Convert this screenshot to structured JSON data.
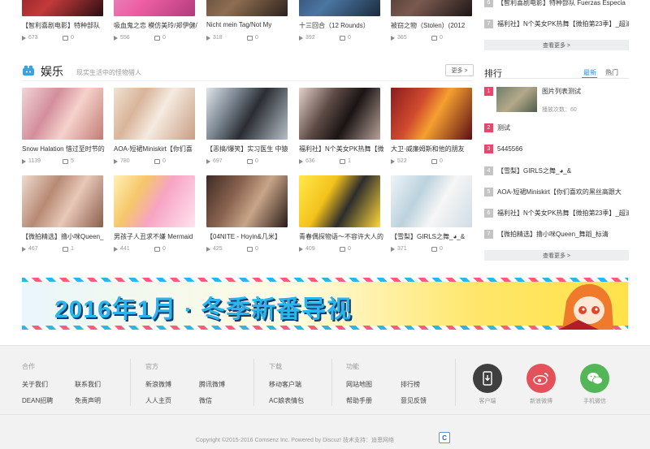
{
  "top_row": [
    {
      "caption": "【智利喜剧电影】特种部队",
      "plays": "673",
      "comments": "0"
    },
    {
      "caption": "吸血鬼之恋 模仿美玲/郑伊健/",
      "plays": "556",
      "comments": "0"
    },
    {
      "caption": "Nicht mein Tag/Not My",
      "plays": "318",
      "comments": "0"
    },
    {
      "caption": "十三回合（12 Rounds）",
      "plays": "392",
      "comments": "0"
    },
    {
      "caption": "被窃之物（Stolen）(2012",
      "plays": "365",
      "comments": "0"
    }
  ],
  "section": {
    "title": "娱乐",
    "subtitle": "现实生活中的怪物猎人",
    "more": "更多 >"
  },
  "row1": [
    {
      "caption": "Snow Halation 惜过至时节的",
      "plays": "1139",
      "comments": "5"
    },
    {
      "caption": "AOA-短裙Miniskirt【你们喜",
      "plays": "780",
      "comments": "0"
    },
    {
      "caption": "【恶搞/爆笑】实习医生 中猿",
      "plays": "697",
      "comments": "0"
    },
    {
      "caption": "福利社】N个美女PK热舞【微",
      "plays": "636",
      "comments": "1"
    },
    {
      "caption": "大卫·威廉姆斯和他的朋友",
      "plays": "522",
      "comments": "0"
    }
  ],
  "row2": [
    {
      "caption": "【微拍精选】撸小咪Queen_",
      "plays": "467",
      "comments": "1"
    },
    {
      "caption": "男孩子人丑求不嫌 Mermaid",
      "plays": "441",
      "comments": "0"
    },
    {
      "caption": "【04NITE - Hoyin&几米】",
      "plays": "425",
      "comments": "0"
    },
    {
      "caption": "青春偶探物语～不容许大人的",
      "plays": "409",
      "comments": "0"
    },
    {
      "caption": "【雪梨】GIRLS之舞_◕_&",
      "plays": "371",
      "comments": "0"
    }
  ],
  "sidebar_top": {
    "items": [
      {
        "num": "6",
        "text": "【智利喜剧电影】特种部队 Fuerzas Especia"
      },
      {
        "num": "7",
        "text": "福利社】N个美女PK热舞【微拍第23季】_超清"
      }
    ],
    "more": "查看更多 >"
  },
  "ranking": {
    "title": "排行",
    "tabs": [
      "最新",
      "热门"
    ],
    "featured": {
      "num": "1",
      "title": "图片列表测试",
      "meta": "播放次数：60"
    },
    "items": [
      {
        "num": "2",
        "text": "测试"
      },
      {
        "num": "3",
        "text": "5445566"
      },
      {
        "num": "4",
        "text": "【雪梨】GIRLS之舞_◕_&"
      },
      {
        "num": "5",
        "text": "AOA-短裙Miniskirt【你们喜欢的黑丝高跟大"
      },
      {
        "num": "6",
        "text": "福利社】N个美女PK热舞【微拍第23季】_超清"
      },
      {
        "num": "7",
        "text": "【微拍精选】撸小咪Queen_舞蹈_标清"
      }
    ],
    "more": "查看更多 >"
  },
  "banner": {
    "text": "2016年1月 · 冬季新番导视"
  },
  "footer": {
    "cols": [
      {
        "heading": "合作",
        "links": [
          "关于我们",
          "联系我们",
          "DEAN招聘",
          "免责声明"
        ]
      },
      {
        "heading": "官方",
        "links": [
          "新浪微博",
          "腾讯微博",
          "人人主页",
          "微信"
        ]
      },
      {
        "heading": "下载",
        "links": [
          "移动客户端",
          "AC娘表情包"
        ]
      },
      {
        "heading": "功能",
        "links": [
          "网站地图",
          "排行榜",
          "帮助手册",
          "意见反馈"
        ]
      }
    ],
    "apps": [
      {
        "label": "客户端",
        "color": "#3f3f3f"
      },
      {
        "label": "新浪微博",
        "color": "#e4515a"
      },
      {
        "label": "手机微信",
        "color": "#53b757"
      }
    ],
    "copyright": "Copyright ©2015-2016 Comsenz Inc. Powered by Discuz! 技术支持：迪恩网络"
  }
}
